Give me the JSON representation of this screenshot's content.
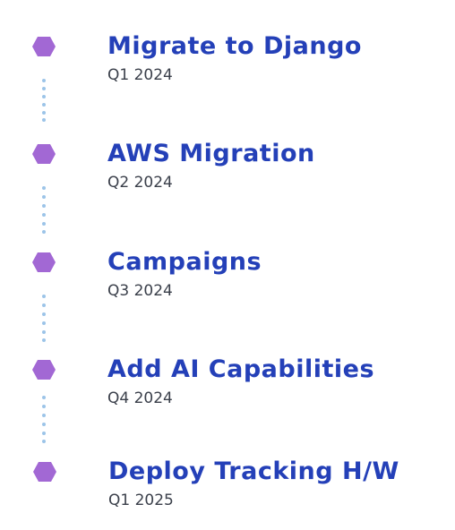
{
  "colors": {
    "hex_fill": "#a268d4",
    "title": "#2440b8",
    "date": "#3a3f4a",
    "dots": "#9cc4e8"
  },
  "milestones": [
    {
      "title": "Migrate to Django",
      "date": "Q1 2024"
    },
    {
      "title": "AWS Migration",
      "date": "Q2 2024"
    },
    {
      "title": "Campaigns",
      "date": "Q3 2024"
    },
    {
      "title": "Add AI Capabilities",
      "date": "Q4 2024"
    },
    {
      "title": "Deploy Tracking H/W",
      "date": "Q1 2025"
    }
  ]
}
